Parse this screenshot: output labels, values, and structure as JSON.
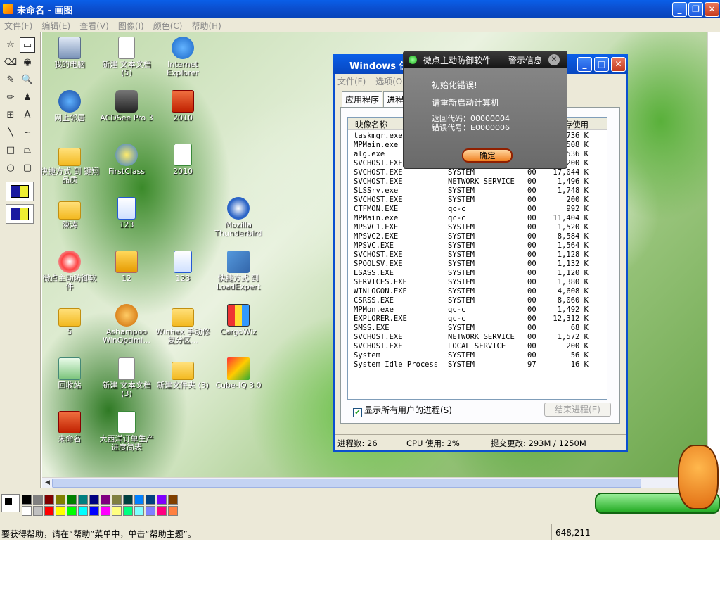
{
  "window": {
    "title": "未命名 - 画图"
  },
  "menu": [
    "文件(F)",
    "编辑(E)",
    "查看(V)",
    "图像(I)",
    "颜色(C)",
    "帮助(H)"
  ],
  "tools": [
    "☆",
    "▭",
    "⌫",
    "◉",
    "✎",
    "🔍",
    "✏",
    "♟",
    "⊞",
    "A",
    "╲",
    "∽",
    "□",
    "⏢",
    "○",
    "▢"
  ],
  "desktop_icons": [
    {
      "label": "我的电脑",
      "icon": "computer-icon",
      "cls": "pc"
    },
    {
      "label": "新建 文本文档 (5)",
      "icon": "text-doc-icon",
      "cls": "doc"
    },
    {
      "label": "Internet Explorer",
      "icon": "ie-icon",
      "cls": "ie"
    },
    {
      "label": "网上邻居",
      "icon": "network-icon",
      "cls": "net"
    },
    {
      "label": "ACDSee Pro 3",
      "icon": "acdsee-icon",
      "cls": "acd"
    },
    {
      "label": "2010",
      "icon": "png-file-icon",
      "cls": "png"
    },
    {
      "label": "快捷方式 到 键翔品质",
      "icon": "folder-icon",
      "cls": "fold"
    },
    {
      "label": "FirstClass",
      "icon": "firstclass-icon",
      "cls": "fc"
    },
    {
      "label": "2010",
      "icon": "excel-file-icon",
      "cls": "xls"
    },
    {
      "label": "陳涛",
      "icon": "folder-icon",
      "cls": "fold"
    },
    {
      "label": "123",
      "icon": "word-file-icon",
      "cls": "word"
    },
    {
      "label": "Mozilla Thunderbird",
      "icon": "thunderbird-icon",
      "cls": "tb"
    },
    {
      "label": "微点主动防御软件",
      "icon": "weidian-icon",
      "cls": "wd"
    },
    {
      "label": "12",
      "icon": "jpg-file-icon",
      "cls": "jpg"
    },
    {
      "label": "123",
      "icon": "word-file-icon",
      "cls": "word"
    },
    {
      "label": "快捷方式 到 LoadExpert",
      "icon": "loadexpert-icon",
      "cls": "le"
    },
    {
      "label": "5",
      "icon": "folder-icon",
      "cls": "fold"
    },
    {
      "label": "Ashampoo WinOptimi...",
      "icon": "ashampoo-icon",
      "cls": "ash"
    },
    {
      "label": "Winhex 手动修复分区...",
      "icon": "folder-icon",
      "cls": "fold"
    },
    {
      "label": "CargoWiz",
      "icon": "cargowiz-icon",
      "cls": "cargo"
    },
    {
      "label": "回收站",
      "icon": "recycle-bin-icon",
      "cls": "rec"
    },
    {
      "label": "新建 文本文档 (3)",
      "icon": "text-doc-icon",
      "cls": "doc"
    },
    {
      "label": "新建文件夹 (3)",
      "icon": "folder-icon",
      "cls": "fold"
    },
    {
      "label": "Cube-IQ 3.0",
      "icon": "cubeiq-icon",
      "cls": "cube"
    },
    {
      "label": "未命名",
      "icon": "png-file-icon",
      "cls": "png"
    },
    {
      "label": "大西洋订单生产进度简表",
      "icon": "excel-file-icon",
      "cls": "xls"
    }
  ],
  "taskmgr": {
    "title": "Windows 任",
    "menu": [
      "文件(F)",
      "选项(O)"
    ],
    "tabs": [
      "应用程序",
      "进程"
    ],
    "columns": {
      "image": "映像名称",
      "mem": "存使用"
    },
    "processes": [
      [
        "taskmgr.exe",
        "",
        "",
        "736 K"
      ],
      [
        "MPMain.exe",
        "",
        "",
        "508 K"
      ],
      [
        "alg.exe",
        "",
        "",
        "536 K"
      ],
      [
        "SVCHOST.EXE",
        "",
        "",
        "200 K"
      ],
      [
        "SVCHOST.EXE",
        "SYSTEM",
        "00",
        "17,044 K"
      ],
      [
        "SVCHOST.EXE",
        "NETWORK SERVICE",
        "00",
        "1,496 K"
      ],
      [
        "SLSSrv.exe",
        "SYSTEM",
        "00",
        "1,748 K"
      ],
      [
        "SVCHOST.EXE",
        "SYSTEM",
        "00",
        "200 K"
      ],
      [
        "CTFMON.EXE",
        "qc-c",
        "00",
        "992 K"
      ],
      [
        "MPMain.exe",
        "qc-c",
        "00",
        "11,404 K"
      ],
      [
        "MPSVC1.EXE",
        "SYSTEM",
        "00",
        "1,520 K"
      ],
      [
        "MPSVC2.EXE",
        "SYSTEM",
        "00",
        "8,584 K"
      ],
      [
        "MPSVC.EXE",
        "SYSTEM",
        "00",
        "1,564 K"
      ],
      [
        "SVCHOST.EXE",
        "SYSTEM",
        "00",
        "1,128 K"
      ],
      [
        "SPOOLSV.EXE",
        "SYSTEM",
        "00",
        "1,132 K"
      ],
      [
        "LSASS.EXE",
        "SYSTEM",
        "00",
        "1,120 K"
      ],
      [
        "SERVICES.EXE",
        "SYSTEM",
        "00",
        "1,380 K"
      ],
      [
        "WINLOGON.EXE",
        "SYSTEM",
        "00",
        "4,608 K"
      ],
      [
        "CSRSS.EXE",
        "SYSTEM",
        "00",
        "8,060 K"
      ],
      [
        "MPMon.exe",
        "qc-c",
        "00",
        "1,492 K"
      ],
      [
        "EXPLORER.EXE",
        "qc-c",
        "00",
        "12,312 K"
      ],
      [
        "SMSS.EXE",
        "SYSTEM",
        "00",
        "68 K"
      ],
      [
        "SVCHOST.EXE",
        "NETWORK SERVICE",
        "00",
        "1,572 K"
      ],
      [
        "SVCHOST.EXE",
        "LOCAL SERVICE",
        "00",
        "200 K"
      ],
      [
        "System",
        "SYSTEM",
        "00",
        "56 K"
      ],
      [
        "System Idle Process",
        "SYSTEM",
        "97",
        "16 K"
      ]
    ],
    "show_all_label": "显示所有用户的进程(S)",
    "end_process": "结束进程(E)",
    "status": {
      "procs": "进程数: 26",
      "cpu": "CPU 使用: 2%",
      "commit": "提交更改: 293M / 1250M"
    }
  },
  "alert": {
    "title1": "微点主动防御软件",
    "title2": "警示信息",
    "line1": "初始化错误!",
    "line2": "请重新启动计算机",
    "line3": "返回代码：00000004",
    "line4": "错误代号：E0000006",
    "ok": "确定"
  },
  "palette": {
    "colors": [
      "#000000",
      "#808080",
      "#800000",
      "#808000",
      "#008000",
      "#008080",
      "#000080",
      "#800080",
      "#808040",
      "#004040",
      "#0080ff",
      "#004080",
      "#8000ff",
      "#804000",
      "#ffffff",
      "#c0c0c0",
      "#ff0000",
      "#ffff00",
      "#00ff00",
      "#00ffff",
      "#0000ff",
      "#ff00ff",
      "#ffff80",
      "#00ff80",
      "#80ffff",
      "#8080ff",
      "#ff0080",
      "#ff8040"
    ]
  },
  "statusbar": {
    "help": "要获得帮助，请在“帮助”菜单中，单击“帮助主题”。",
    "coords": "648,211"
  }
}
